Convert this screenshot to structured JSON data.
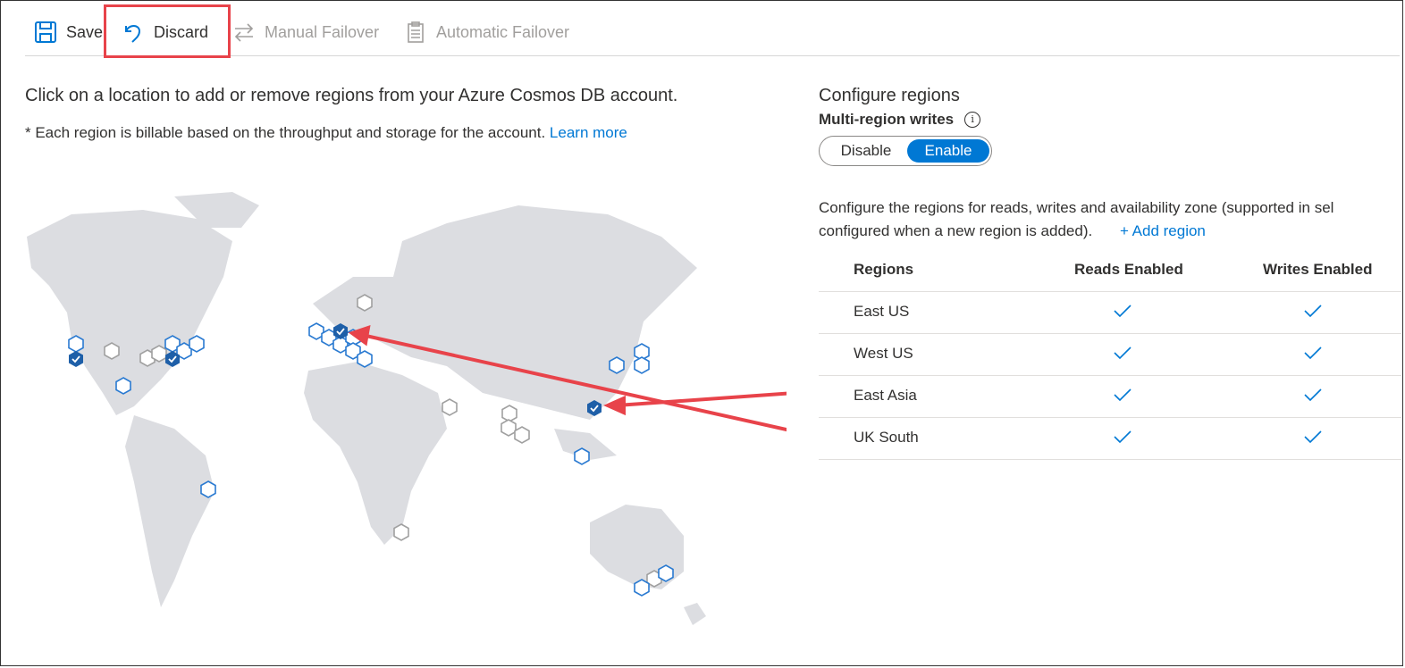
{
  "toolbar": {
    "save_label": "Save",
    "discard_label": "Discard",
    "manual_failover_label": "Manual Failover",
    "automatic_failover_label": "Automatic Failover"
  },
  "intro": {
    "text": "Click on a location to add or remove regions from your Azure Cosmos DB account.",
    "note": "* Each region is billable based on the throughput and storage for the account.",
    "learn_more": "Learn more"
  },
  "config": {
    "title": "Configure regions",
    "multi_region_label": "Multi-region writes",
    "toggle": {
      "off": "Disable",
      "on": "Enable",
      "selected": "Enable"
    },
    "description_line1": "Configure the regions for reads, writes and availability zone (supported in sel",
    "description_line2": "configured when a new region is added).",
    "add_region": "+ Add region"
  },
  "table": {
    "headers": [
      "Regions",
      "Reads Enabled",
      "Writes Enabled"
    ],
    "rows": [
      {
        "region": "East US",
        "reads": true,
        "writes": true
      },
      {
        "region": "West US",
        "reads": true,
        "writes": true
      },
      {
        "region": "East Asia",
        "reads": true,
        "writes": true
      },
      {
        "region": "UK South",
        "reads": true,
        "writes": true
      }
    ]
  },
  "colors": {
    "accent": "#0078d4",
    "region_selected": "#1e5fa8",
    "region_available": "#2a7ad1",
    "region_unavailable": "#a0a0a0",
    "highlight": "#e8434a",
    "map_land": "#dcdde1"
  }
}
